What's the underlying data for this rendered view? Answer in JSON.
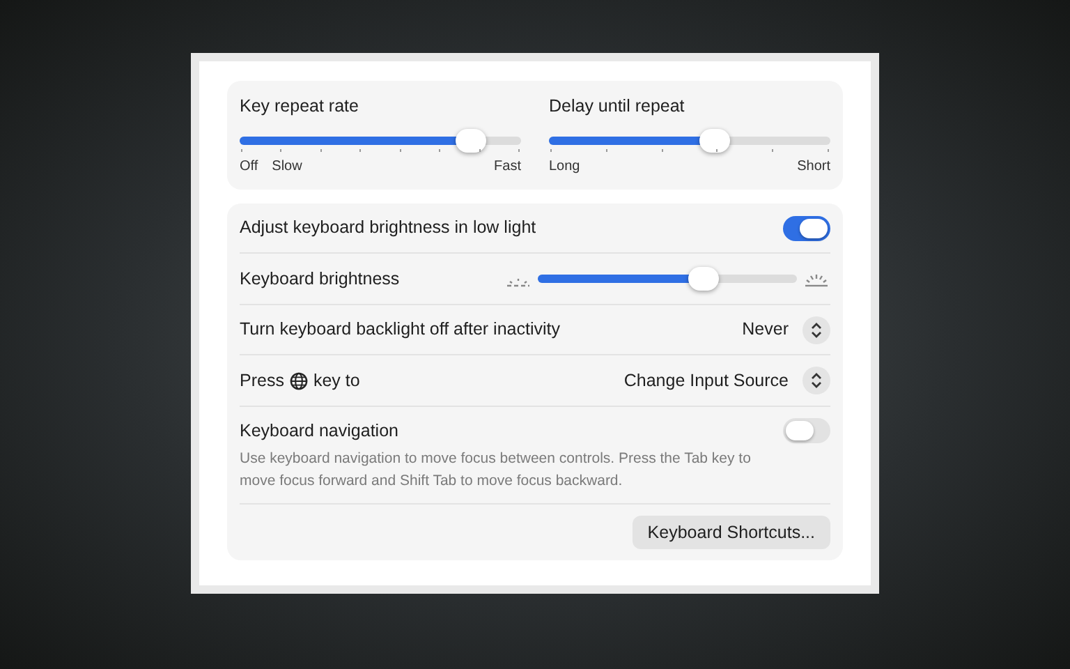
{
  "sliders": [
    {
      "title": "Key repeat rate",
      "level": 0.82,
      "kind": "rate",
      "labels": [
        "Off",
        "Slow",
        "Fast"
      ]
    },
    {
      "title": "Delay until repeat",
      "level": 0.59,
      "kind": "delay",
      "labels": [
        "Long",
        "Short"
      ]
    }
  ],
  "rows": [
    {
      "kind": "toggle",
      "label": "Adjust keyboard brightness in low light",
      "on": true
    },
    {
      "kind": "slider",
      "label": "Keyboard brightness",
      "level": 0.64
    },
    {
      "kind": "popup",
      "label": "Turn keyboard backlight off after inactivity",
      "value": "Never"
    },
    {
      "kind": "popup-globe",
      "label": "Press",
      "label_after": "key to",
      "value": "Change Input Source"
    },
    {
      "kind": "toggle",
      "label": "Keyboard navigation",
      "on": false,
      "description": "Use keyboard navigation to move focus between controls. Press the Tab key to move focus forward and Shift Tab to move focus backward."
    },
    {
      "kind": "button",
      "label": "Keyboard Shortcuts..."
    }
  ]
}
